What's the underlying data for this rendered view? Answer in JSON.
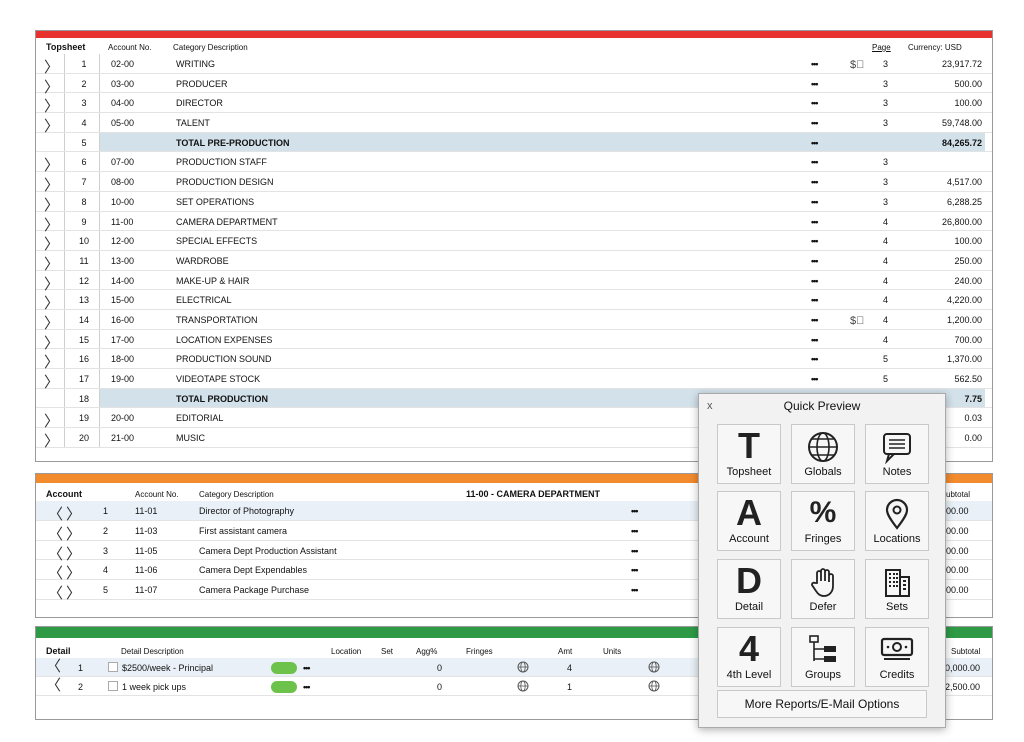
{
  "topsheet": {
    "accent": "#e8322f",
    "title": "Topsheet",
    "col_account": "Account No.",
    "col_desc": "Category Description",
    "col_page": "Page",
    "col_currency": "Currency: USD",
    "rows": [
      {
        "num": "1",
        "acct": "02-00",
        "desc": "WRITING",
        "page": "3",
        "amt": "23,917.72",
        "money": true
      },
      {
        "num": "2",
        "acct": "03-00",
        "desc": "PRODUCER",
        "page": "3",
        "amt": "500.00"
      },
      {
        "num": "3",
        "acct": "04-00",
        "desc": "DIRECTOR",
        "page": "3",
        "amt": "100.00"
      },
      {
        "num": "4",
        "acct": "05-00",
        "desc": "TALENT",
        "page": "3",
        "amt": "59,748.00"
      },
      {
        "num": "5",
        "acct": "",
        "desc": "TOTAL PRE-PRODUCTION",
        "page": "",
        "amt": "84,265.72",
        "total": true
      },
      {
        "num": "6",
        "acct": "07-00",
        "desc": "PRODUCTION STAFF",
        "page": "3",
        "amt": ""
      },
      {
        "num": "7",
        "acct": "08-00",
        "desc": "PRODUCTION DESIGN",
        "page": "3",
        "amt": "4,517.00"
      },
      {
        "num": "8",
        "acct": "10-00",
        "desc": "SET OPERATIONS",
        "page": "3",
        "amt": "6,288.25"
      },
      {
        "num": "9",
        "acct": "11-00",
        "desc": "CAMERA DEPARTMENT",
        "page": "4",
        "amt": "26,800.00"
      },
      {
        "num": "10",
        "acct": "12-00",
        "desc": "SPECIAL EFFECTS",
        "page": "4",
        "amt": "100.00"
      },
      {
        "num": "11",
        "acct": "13-00",
        "desc": "WARDROBE",
        "page": "4",
        "amt": "250.00"
      },
      {
        "num": "12",
        "acct": "14-00",
        "desc": "MAKE-UP & HAIR",
        "page": "4",
        "amt": "240.00"
      },
      {
        "num": "13",
        "acct": "15-00",
        "desc": "ELECTRICAL",
        "page": "4",
        "amt": "4,220.00"
      },
      {
        "num": "14",
        "acct": "16-00",
        "desc": "TRANSPORTATION",
        "page": "4",
        "amt": "1,200.00",
        "money": true
      },
      {
        "num": "15",
        "acct": "17-00",
        "desc": "LOCATION EXPENSES",
        "page": "4",
        "amt": "700.00"
      },
      {
        "num": "16",
        "acct": "18-00",
        "desc": "PRODUCTION SOUND",
        "page": "5",
        "amt": "1,370.00"
      },
      {
        "num": "17",
        "acct": "19-00",
        "desc": "VIDEOTAPE STOCK",
        "page": "5",
        "amt": "562.50"
      },
      {
        "num": "18",
        "acct": "",
        "desc": "TOTAL PRODUCTION",
        "page": "",
        "amt": "7.75",
        "total": true
      },
      {
        "num": "19",
        "acct": "20-00",
        "desc": "EDITORIAL",
        "page": "",
        "amt": "0.03"
      },
      {
        "num": "20",
        "acct": "21-00",
        "desc": "MUSIC",
        "page": "",
        "amt": "0.00"
      }
    ]
  },
  "account": {
    "accent": "#f28a2e",
    "title": "Account",
    "col_account": "Account No.",
    "col_desc": "Category Description",
    "heading": "11-00 - CAMERA DEPARTMENT",
    "col_subtotal": "ubtotal",
    "rows": [
      {
        "num": "1",
        "acct": "11-01",
        "desc": "Director of Photography",
        "amt": "00.00",
        "selected": true
      },
      {
        "num": "2",
        "acct": "11-03",
        "desc": "First assistant camera",
        "amt": "00.00"
      },
      {
        "num": "3",
        "acct": "11-05",
        "desc": "Camera Dept Production Assistant",
        "amt": "00.00"
      },
      {
        "num": "4",
        "acct": "11-06",
        "desc": "Camera Dept Expendables",
        "amt": "00.00"
      },
      {
        "num": "5",
        "acct": "11-07",
        "desc": "Camera Package Purchase",
        "amt": "00.00"
      }
    ]
  },
  "detail": {
    "accent": "#2e9a46",
    "title": "Detail",
    "col_desc": "Detail Description",
    "col_location": "Location",
    "col_set": "Set",
    "col_agg": "Agg%",
    "col_fringes": "Fringes",
    "col_amt": "Amt",
    "col_units": "Units",
    "col_subtotal": "Subtotal",
    "rows": [
      {
        "num": "1",
        "desc": "$2500/week - Principal",
        "agg": "0",
        "amt": "4",
        "subtotal": "0,000.00",
        "selected": true
      },
      {
        "num": "2",
        "desc": "1 week pick ups",
        "agg": "0",
        "amt": "1",
        "subtotal": "2,500.00"
      }
    ]
  },
  "quick_preview": {
    "title": "Quick Preview",
    "close": "x",
    "tiles": [
      {
        "label": "Topsheet",
        "glyph": "T",
        "icon": "topsheet-icon"
      },
      {
        "label": "Globals",
        "glyph": "",
        "icon": "globe-icon"
      },
      {
        "label": "Notes",
        "glyph": "",
        "icon": "notes-icon"
      },
      {
        "label": "Account",
        "glyph": "A",
        "icon": "account-icon"
      },
      {
        "label": "Fringes",
        "glyph": "%",
        "icon": "percent-icon"
      },
      {
        "label": "Locations",
        "glyph": "",
        "icon": "location-pin-icon"
      },
      {
        "label": "Detail",
        "glyph": "D",
        "icon": "detail-icon"
      },
      {
        "label": "Defer",
        "glyph": "",
        "icon": "hand-icon"
      },
      {
        "label": "Sets",
        "glyph": "",
        "icon": "building-icon"
      },
      {
        "label": "4th Level",
        "glyph": "4",
        "icon": "fourth-level-icon"
      },
      {
        "label": "Groups",
        "glyph": "",
        "icon": "groups-icon"
      },
      {
        "label": "Credits",
        "glyph": "",
        "icon": "money-icon"
      }
    ],
    "more_label": "More Reports/E-Mail Options"
  },
  "dots": "•••"
}
